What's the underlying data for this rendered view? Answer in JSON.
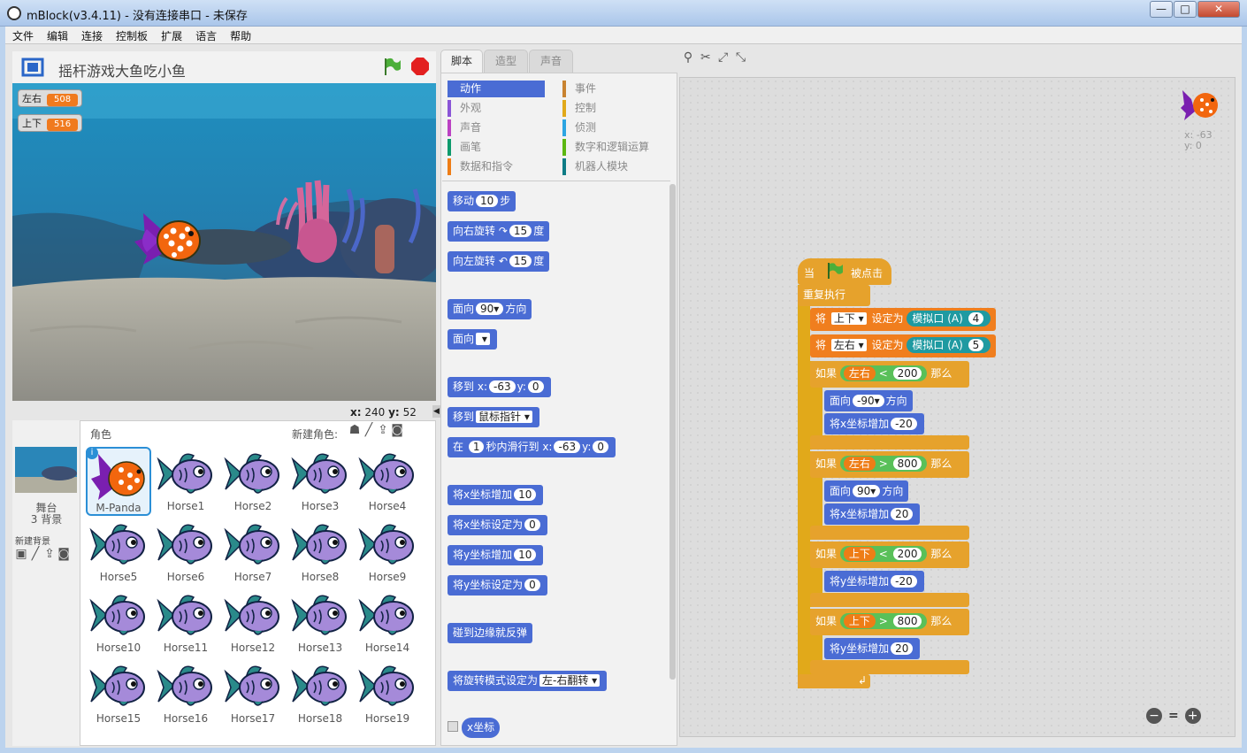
{
  "window": {
    "title": "mBlock(v3.4.11) - 没有连接串口 - 未保存",
    "btn_min": "—",
    "btn_max": "□",
    "btn_close": "✕"
  },
  "menu": [
    "文件",
    "编辑",
    "连接",
    "控制板",
    "扩展",
    "语言",
    "帮助"
  ],
  "stage": {
    "title": "摇杆游戏大鱼吃小鱼",
    "monitors": [
      {
        "label": "左右",
        "value": "508"
      },
      {
        "label": "上下",
        "value": "516"
      }
    ],
    "x_label": "x:",
    "x": "240",
    "y_label": "y:",
    "y": "52"
  },
  "sprites_panel": {
    "header": "角色",
    "new_sprite": "新建角色:",
    "stage_label": "舞台",
    "backdrops": "3 背景",
    "new_backdrop": "新建背景",
    "sprites": [
      "M-Panda",
      "Horse1",
      "Horse2",
      "Horse3",
      "Horse4",
      "Horse5",
      "Horse6",
      "Horse7",
      "Horse8",
      "Horse9",
      "Horse10",
      "Horse11",
      "Horse12",
      "Horse13",
      "Horse14",
      "Horse15",
      "Horse16",
      "Horse17",
      "Horse18",
      "Horse19"
    ]
  },
  "tabs": [
    "脚本",
    "造型",
    "声音"
  ],
  "categories": [
    {
      "label": "动作",
      "color": "#4a6cd4"
    },
    {
      "label": "外观",
      "color": "#8a55d7"
    },
    {
      "label": "声音",
      "color": "#bb42c3"
    },
    {
      "label": "画笔",
      "color": "#0e9a6c"
    },
    {
      "label": "数据和指令",
      "color": "#ee7d16"
    },
    {
      "label": "事件",
      "color": "#c88330"
    },
    {
      "label": "控制",
      "color": "#e1a91a"
    },
    {
      "label": "侦测",
      "color": "#2ca5e2"
    },
    {
      "label": "数字和逻辑运算",
      "color": "#5cb712"
    },
    {
      "label": "机器人模块",
      "color": "#0e7c86"
    }
  ],
  "palette": {
    "move": "移动",
    "move_v": "10",
    "move_u": "步",
    "turn_r": "向右旋转",
    "turn_r_icon": "↷",
    "turn_r_v": "15",
    "deg": "度",
    "turn_l": "向左旋转",
    "turn_l_icon": "↶",
    "turn_l_v": "15",
    "point_dir": "面向",
    "point_dir_v": "90",
    "point_dir_u": "方向",
    "point_to": "面向",
    "goto_xy": "移到",
    "x": "x:",
    "goto_x": "-63",
    "y": "y:",
    "goto_y": "0",
    "goto": "移到",
    "goto_v": "鼠标指针",
    "glide": "在",
    "glide_v": "1",
    "glide_mid": "秒内滑行到",
    "glide_x": "-63",
    "glide_y": "0",
    "chx": "将x坐标增加",
    "chx_v": "10",
    "setx": "将x坐标设定为",
    "setx_v": "0",
    "chy": "将y坐标增加",
    "chy_v": "10",
    "sety": "将y坐标设定为",
    "sety_v": "0",
    "bounce": "碰到边缘就反弹",
    "rot": "将旋转模式设定为",
    "rot_v": "左-右翻转",
    "xpos": "x坐标"
  },
  "sprite_info": {
    "x": "x: -63",
    "y": "y: 0"
  },
  "script": {
    "hat_when": "当",
    "hat_clicked": "被点击",
    "forever": "重复执行",
    "set": "将",
    "var_ud": "上下",
    "var_lr": "左右",
    "set_to": "设定为",
    "analog": "模拟口 (A)",
    "port_ud": "4",
    "port_lr": "5",
    "if": "如果",
    "then": "那么",
    "lt": "<",
    "gt": ">",
    "v200": "200",
    "v800": "800",
    "face": "面向",
    "dir_m90": "-90",
    "dir_90": "90",
    "dir_u": "方向",
    "chx": "将x坐标增加",
    "chy": "将y坐标增加",
    "m20": "-20",
    "p20": "20",
    "loop_arrow": "↲"
  },
  "zoom": {
    "out": "−",
    "reset": "=",
    "in": "+"
  }
}
